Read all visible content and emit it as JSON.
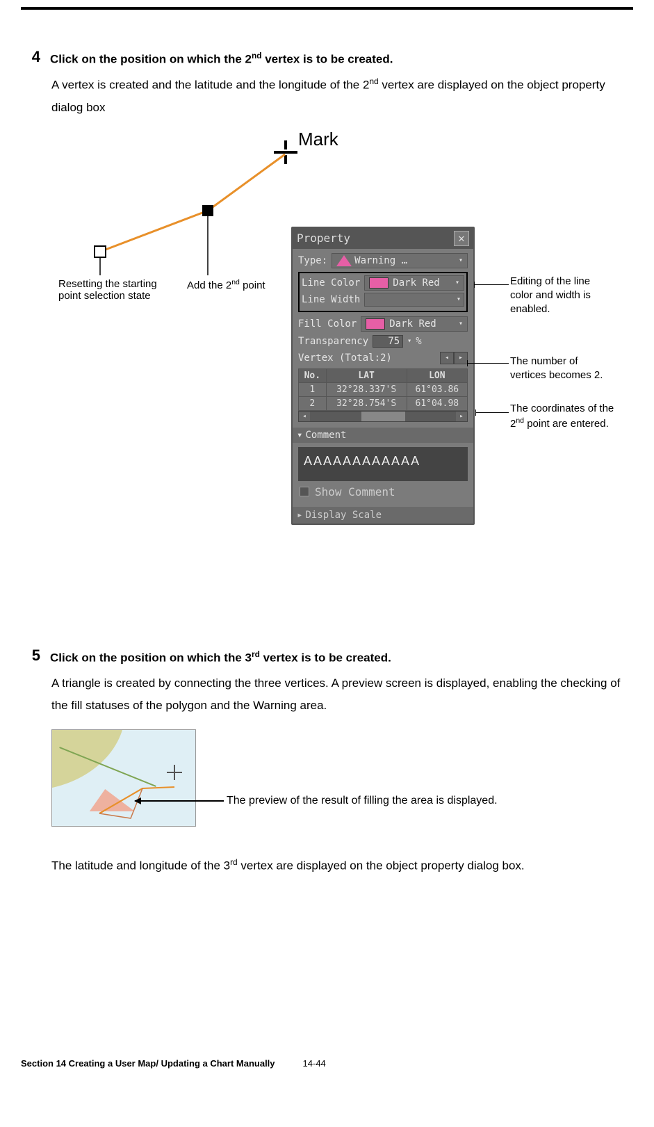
{
  "steps": {
    "s4": {
      "num": "4",
      "title_pre": "Click on the position on which the 2",
      "title_sup": "nd",
      "title_post": " vertex is to be created.",
      "body_pre": "A vertex is created and the latitude and the longitude of the 2",
      "body_sup": "nd",
      "body_post": " vertex are displayed on the object property dialog box"
    },
    "s5": {
      "num": "5",
      "title_pre": "Click on the position on which the 3",
      "title_sup": "rd",
      "title_post": " vertex is to be created.",
      "body": "A triangle is created by connecting the three vertices. A preview screen is displayed, enabling the checking of the fill statuses of the polygon and the Warning area."
    }
  },
  "fig1": {
    "mark": "Mark",
    "reset": "Resetting the starting point selection state",
    "add_pre": "Add the 2",
    "add_sup": "nd",
    "add_post": " point"
  },
  "panel": {
    "title": "Property",
    "type_label": "Type:",
    "type_value": "Warning …",
    "line_color_label": "Line Color",
    "line_color_value": "Dark Red",
    "line_width_label": "Line Width",
    "fill_color_label": "Fill Color",
    "fill_color_value": "Dark Red",
    "transparency_label": "Transparency",
    "transparency_value": "75",
    "percent": "%",
    "vertex_label": "Vertex (Total:2)",
    "col_no": "No.",
    "col_lat": "LAT",
    "col_lon": "LON",
    "rows": [
      {
        "no": "1",
        "lat": "32°28.337'S",
        "lon": "61°03.86"
      },
      {
        "no": "2",
        "lat": "32°28.754'S",
        "lon": "61°04.98"
      }
    ],
    "comment_header": "Comment",
    "comment_value": "AAAAAAAAAAAA",
    "show_comment": "Show Comment",
    "display_scale": "Display Scale"
  },
  "callouts": {
    "c1": "Editing of the line color and width is enabled.",
    "c2": "The number of vertices becomes 2.",
    "c3_pre": "The coordinates of the 2",
    "c3_sup": "nd",
    "c3_post": " point are entered."
  },
  "fig2": {
    "caption": "The preview of the result of filling the area is displayed."
  },
  "bottom": {
    "pre": "The latitude and longitude of the 3",
    "sup": "rd",
    "post": " vertex are displayed on the object property dialog box."
  },
  "footer": {
    "section": "Section 14    Creating a User Map/ Updating a Chart Manually",
    "page": "14-44"
  }
}
